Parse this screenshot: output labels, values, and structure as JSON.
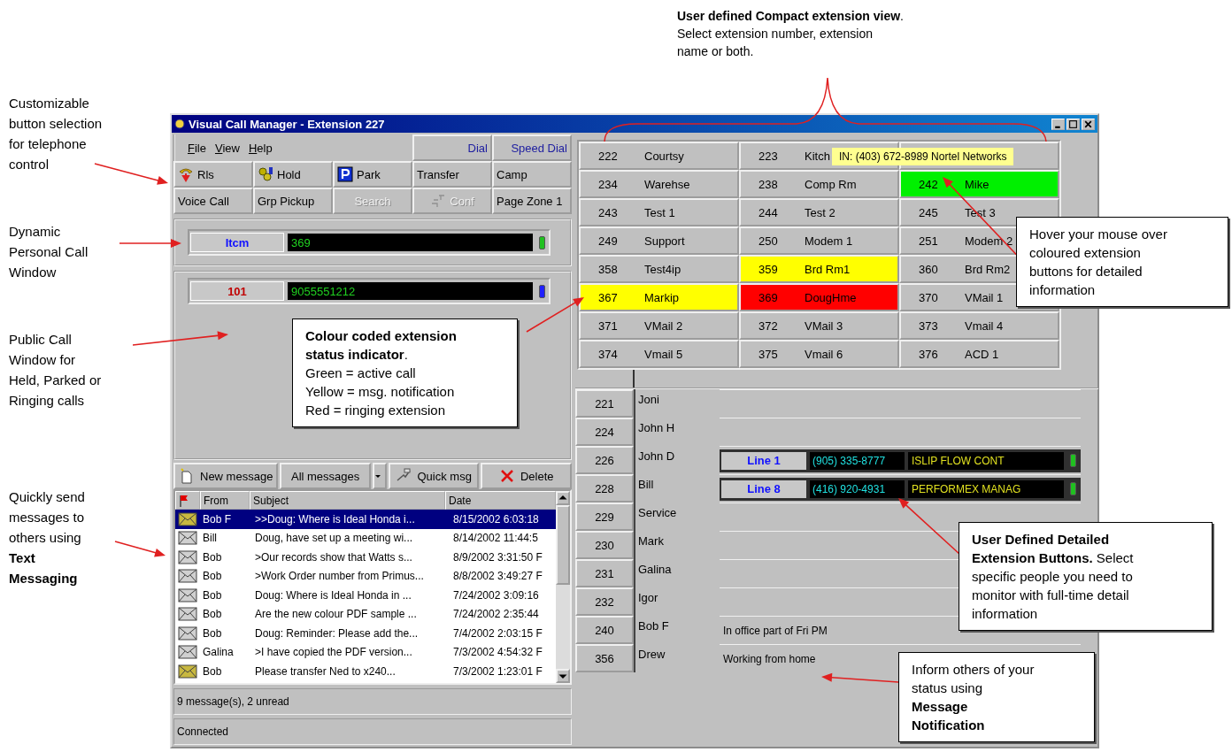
{
  "header_note": "**User defined Compact extension view**.\nSelect extension number, extension\nname or both.",
  "side_notes": [
    "Customizable\nbutton selection\nfor telephone\ncontrol",
    "Dynamic\nPersonal Call\nWindow",
    "Public Call\nWindow for\nHeld, Parked or\nRinging calls",
    "Quickly send\nmessages to\nothers using\n**Text\nMessaging**"
  ],
  "callouts": [
    "**Colour coded extension\nstatus indicator**.\nGreen = active call\nYellow = msg. notification\nRed = ringing extension",
    "Hover your mouse over\ncoloured extension\nbuttons for detailed\ninformation",
    "**User Defined Detailed\nExtension Buttons.**  Select\nspecific people you need to\nmonitor with full-time detail\ninformation",
    "Inform others of your\nstatus using\n**Message\nNotification**"
  ],
  "window": {
    "title": "Visual Call Manager - Extension 227"
  },
  "menu": [
    "File",
    "View",
    "Help"
  ],
  "top_buttons": [
    "Dial",
    "Speed Dial"
  ],
  "button_rows": [
    [
      {
        "label": "Rls",
        "disabled": false
      },
      {
        "label": "Hold",
        "disabled": false
      },
      {
        "label": "Park",
        "disabled": false
      },
      {
        "label": "Transfer",
        "disabled": false
      },
      {
        "label": "Camp",
        "disabled": false
      }
    ],
    [
      {
        "label": "Voice Call",
        "disabled": false
      },
      {
        "label": "Grp Pickup",
        "disabled": false
      },
      {
        "label": "Search",
        "disabled": true
      },
      {
        "label": "Conf",
        "disabled": true
      },
      {
        "label": "Page Zone 1",
        "disabled": false
      }
    ]
  ],
  "personal_call": {
    "label": "Itcm",
    "display": "369"
  },
  "public_calls": [
    {
      "label": "101",
      "display": "9055551212"
    }
  ],
  "message_toolbar": [
    "New message",
    "All messages",
    "Quick msg",
    "Delete"
  ],
  "messages": {
    "columns": [
      "From",
      "Subject",
      "Date"
    ],
    "rows": [
      {
        "from": "Bob F",
        "subject": ">>Doug: Where is Ideal Honda i...",
        "date": "8/15/2002 6:03:18",
        "unread": true,
        "selected": true
      },
      {
        "from": "Bill",
        "subject": "Doug, have set up a meeting wi...",
        "date": "8/14/2002 11:44:5",
        "unread": false,
        "selected": false
      },
      {
        "from": "Bob",
        "subject": ">Our records show that Watts s...",
        "date": "8/9/2002 3:31:50 F",
        "unread": false,
        "selected": false
      },
      {
        "from": "Bob",
        "subject": ">Work Order number from Primus...",
        "date": "8/8/2002 3:49:27 F",
        "unread": false,
        "selected": false
      },
      {
        "from": "Bob",
        "subject": "Doug: Where is Ideal Honda in ...",
        "date": "7/24/2002 3:09:16",
        "unread": false,
        "selected": false
      },
      {
        "from": "Bob",
        "subject": "Are the new colour PDF sample ...",
        "date": "7/24/2002 2:35:44",
        "unread": false,
        "selected": false
      },
      {
        "from": "Bob",
        "subject": "Doug: Reminder: Please add the...",
        "date": "7/4/2002 2:03:15 F",
        "unread": false,
        "selected": false
      },
      {
        "from": "Galina",
        "subject": ">I have copied the PDF version...",
        "date": "7/3/2002 4:54:32 F",
        "unread": false,
        "selected": false
      },
      {
        "from": "Bob",
        "subject": "Please transfer Ned to x240...",
        "date": "7/3/2002 1:23:01 F",
        "unread": true,
        "selected": false
      }
    ],
    "summary": "9 message(s), 2 unread"
  },
  "status_bar": "Connected",
  "tooltip": "IN: (403) 672-8989  Nortel Networks",
  "compact_extensions": [
    {
      "number": "222",
      "name": "Courtsy",
      "color": "#c0c0c0"
    },
    {
      "number": "223",
      "name": "Kitch",
      "color": "#c0c0c0"
    },
    {
      "color": "#c0c0c0"
    },
    {
      "number": "234",
      "name": "Warehse",
      "color": "#c0c0c0"
    },
    {
      "number": "238",
      "name": "Comp Rm",
      "color": "#c0c0c0"
    },
    {
      "number": "242",
      "name": "Mike",
      "color": "#00f000"
    },
    {
      "number": "243",
      "name": "Test 1",
      "color": "#c0c0c0"
    },
    {
      "number": "244",
      "name": "Test 2",
      "color": "#c0c0c0"
    },
    {
      "number": "245",
      "name": "Test 3",
      "color": "#c0c0c0"
    },
    {
      "number": "249",
      "name": "Support",
      "color": "#c0c0c0"
    },
    {
      "number": "250",
      "name": "Modem 1",
      "color": "#c0c0c0"
    },
    {
      "number": "251",
      "name": "Modem 2",
      "color": "#c0c0c0"
    },
    {
      "number": "358",
      "name": "Test4ip",
      "color": "#c0c0c0"
    },
    {
      "number": "359",
      "name": "Brd Rm1",
      "color": "#ffff00"
    },
    {
      "number": "360",
      "name": "Brd Rm2",
      "color": "#c0c0c0"
    },
    {
      "number": "367",
      "name": "Markip",
      "color": "#ffff00"
    },
    {
      "number": "369",
      "name": "DougHme",
      "color": "#ff0000"
    },
    {
      "number": "370",
      "name": "VMail 1",
      "color": "#c0c0c0"
    },
    {
      "number": "371",
      "name": "VMail 2",
      "color": "#c0c0c0"
    },
    {
      "number": "372",
      "name": "VMail 3",
      "color": "#c0c0c0"
    },
    {
      "number": "373",
      "name": "Vmail 4",
      "color": "#c0c0c0"
    },
    {
      "number": "374",
      "name": "Vmail 5",
      "color": "#c0c0c0"
    },
    {
      "number": "375",
      "name": "Vmail 6",
      "color": "#c0c0c0"
    },
    {
      "number": "376",
      "name": "ACD 1",
      "color": "#c0c0c0"
    }
  ],
  "detailed_extensions": [
    {
      "number": "221",
      "name": "Joni",
      "kind": "empty"
    },
    {
      "number": "224",
      "name": "John H",
      "kind": "empty"
    },
    {
      "number": "226",
      "name": "John D",
      "kind": "line",
      "line": "Line 1",
      "phone": "(905) 335-8777",
      "caller": "ISLIP FLOW CONT"
    },
    {
      "number": "228",
      "name": "Bill",
      "kind": "line",
      "line": "Line 8",
      "phone": "(416) 920-4931",
      "caller": "PERFORMEX MANAG"
    },
    {
      "number": "229",
      "name": "Service",
      "kind": "empty"
    },
    {
      "number": "230",
      "name": "Mark",
      "kind": "empty"
    },
    {
      "number": "231",
      "name": "Galina",
      "kind": "empty"
    },
    {
      "number": "232",
      "name": "Igor",
      "kind": "empty"
    },
    {
      "number": "240",
      "name": "Bob F",
      "kind": "note",
      "note": "In office part of Fri PM"
    },
    {
      "number": "356",
      "name": "Drew",
      "kind": "note",
      "note": "Working from home"
    }
  ]
}
